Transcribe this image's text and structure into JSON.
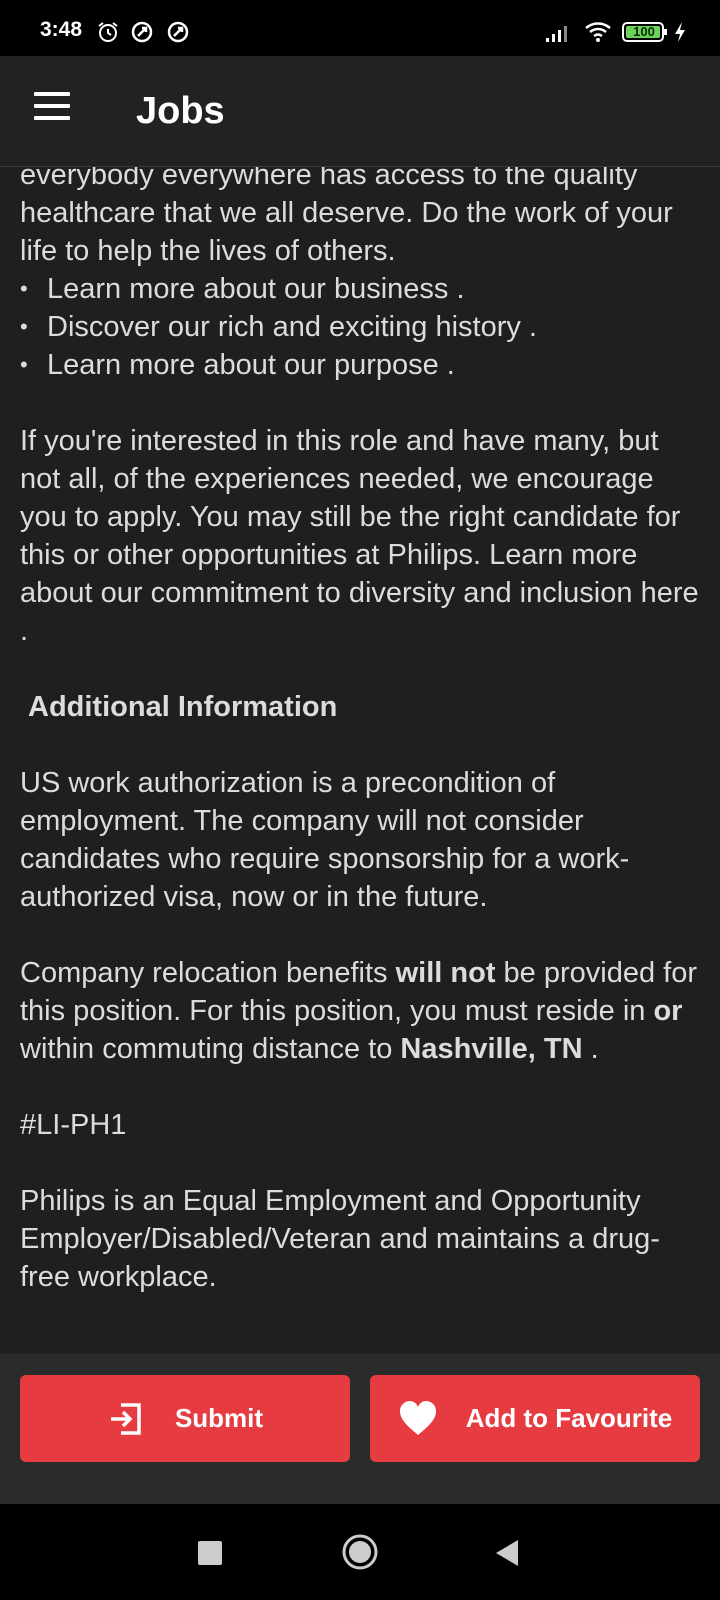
{
  "status_bar": {
    "time": "3:48",
    "battery": "100",
    "icons": [
      "alarm-icon",
      "data-saver-icon",
      "data-saver-icon",
      "signal-icon",
      "wifi-icon",
      "battery-icon",
      "charging-icon"
    ]
  },
  "app_bar": {
    "title": "Jobs",
    "menu_icon": "menu-icon"
  },
  "content": {
    "intro_text": "everybody everywhere has access to the quality healthcare that we all deserve. Do the work of your life to help the lives of others.",
    "bullets": [
      "Learn more about our business .",
      "Discover our rich and exciting history .",
      "Learn more about our purpose ."
    ],
    "interest_text": "If you're interested in this role and have many, but not all, of the experiences needed, we encourage you to apply. You may still be the right candidate for this or other opportunities at Philips. Learn more about our commitment to diversity and inclusion here .",
    "additional_heading": "Additional Information",
    "work_auth_text": "US work authorization is a precondition of employment. The company will not consider candidates who require sponsorship for a work-authorized visa, now or in the future.",
    "relocation": {
      "part1": "Company relocation benefits ",
      "bold1": "will not",
      "part2": " be provided for this position.  For this position, you must reside in ",
      "bold2": "or",
      "part3": " within commuting distance to ",
      "bold3": "Nashville, TN",
      "part4": " ."
    },
    "tag": "#LI-PH1",
    "eeo_text": "Philips is an Equal Employment and Opportunity Employer/Disabled/Veteran and maintains a drug-free workplace."
  },
  "actions": {
    "submit_label": "Submit",
    "favourite_label": "Add to Favourite",
    "button_color": "#e63c41"
  },
  "nav": {
    "recents_icon": "square-icon",
    "home_icon": "circle-icon",
    "back_icon": "triangle-back-icon"
  }
}
